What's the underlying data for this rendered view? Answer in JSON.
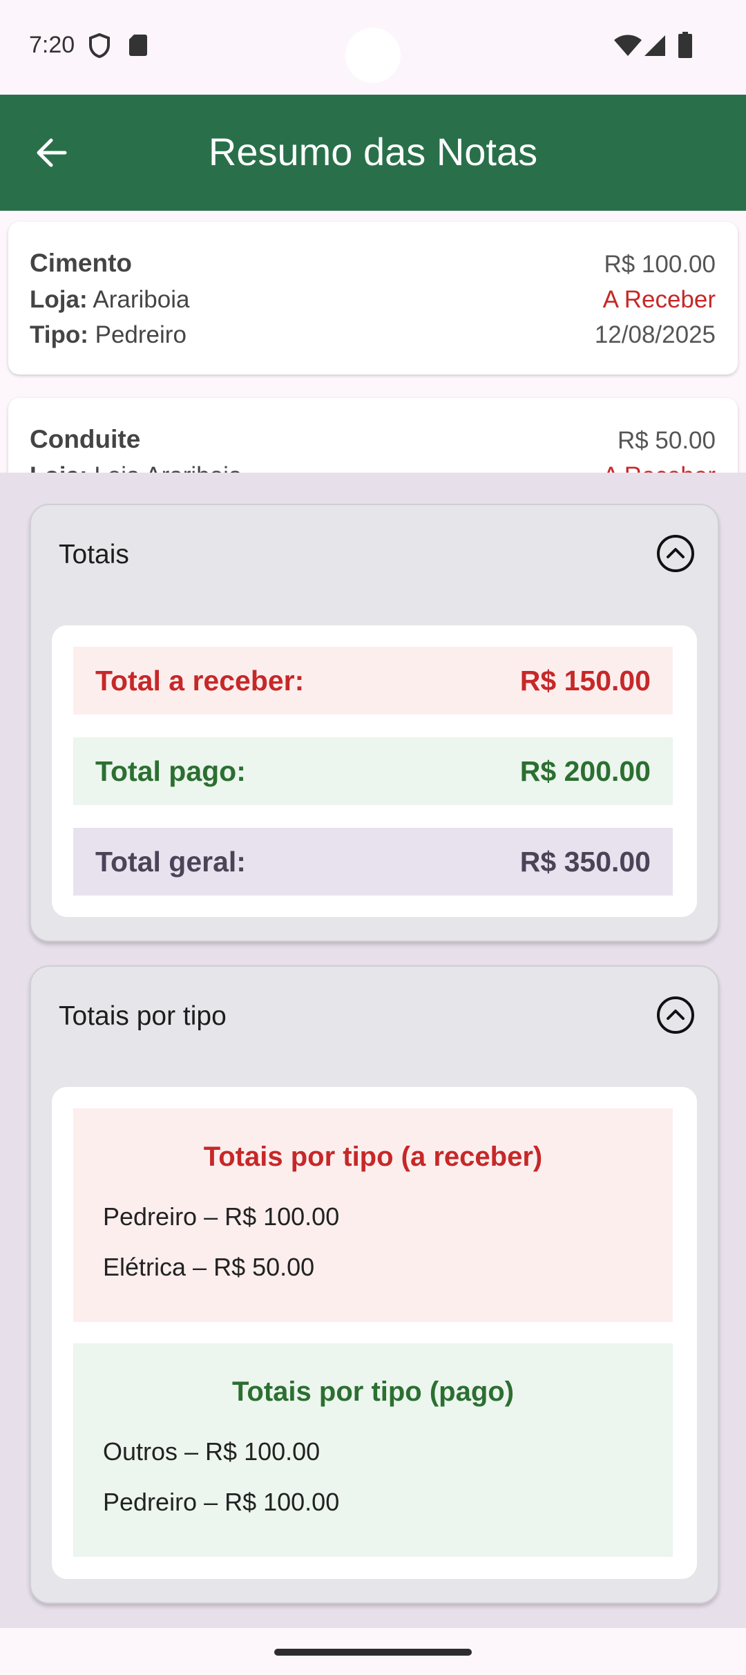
{
  "status_bar": {
    "time": "7:20"
  },
  "app_bar": {
    "title": "Resumo das Notas"
  },
  "notes": [
    {
      "name": "Cimento",
      "loja_label": "Loja:",
      "loja": "Arariboia",
      "tipo_label": "Tipo:",
      "tipo": "Pedreiro",
      "value": "R$ 100.00",
      "status": "A Receber",
      "date": "12/08/2025"
    },
    {
      "name": "Conduite",
      "loja_label": "Loja:",
      "loja": "Loja Arariboia",
      "value": "R$ 50.00",
      "status": "A Receber"
    }
  ],
  "totals_panel": {
    "title": "Totais",
    "receber_label": "Total a receber:",
    "receber_value": "R$ 150.00",
    "pago_label": "Total pago:",
    "pago_value": "R$ 200.00",
    "geral_label": "Total geral:",
    "geral_value": "R$ 350.00"
  },
  "types_panel": {
    "title": "Totais por tipo",
    "receber_title": "Totais por tipo (a receber)",
    "receber_items": [
      "Pedreiro – R$ 100.00",
      "Elétrica – R$ 50.00"
    ],
    "pago_title": "Totais por tipo (pago)",
    "pago_items": [
      "Outros – R$ 100.00",
      "Pedreiro – R$ 100.00"
    ]
  },
  "colors": {
    "app_bar": "#29704a",
    "receber": "#c62828",
    "pago": "#2b6f31"
  }
}
